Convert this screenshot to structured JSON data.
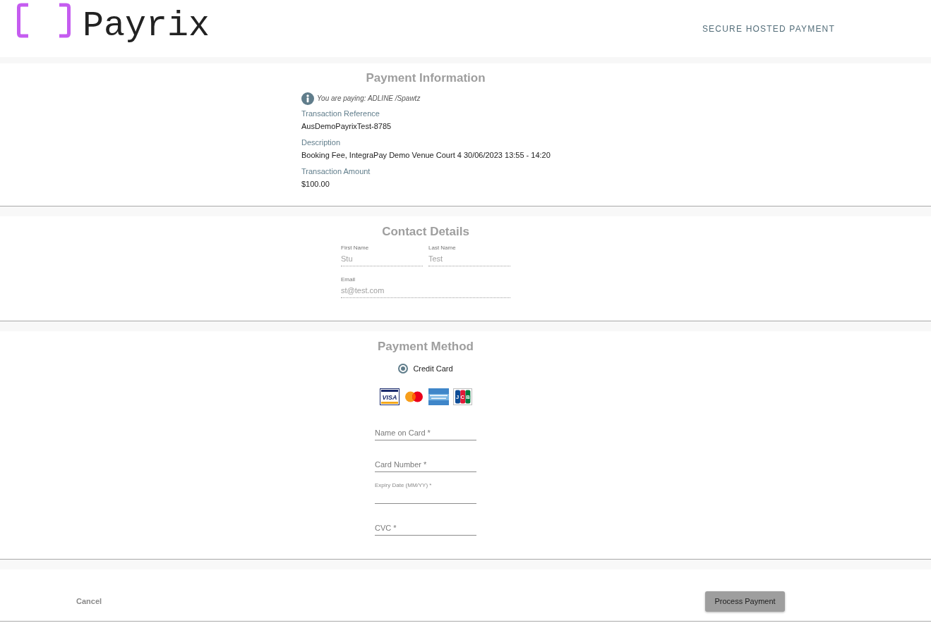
{
  "header": {
    "logo_text": "Payrix",
    "tagline": "SECURE HOSTED PAYMENT"
  },
  "payment_information": {
    "title": "Payment Information",
    "notice": "You are paying: ADLINE /Spawtz",
    "details": [
      {
        "label": "Transaction Reference",
        "value": "AusDemoPayrixTest-8785"
      },
      {
        "label": "Description",
        "value": "Booking Fee, IntegraPay Demo Venue Court 4 30/06/2023 13:55 - 14:20"
      },
      {
        "label": "Transaction Amount",
        "value": "$100.00"
      }
    ]
  },
  "contact_details": {
    "title": "Contact Details",
    "fields": [
      {
        "label": "First Name",
        "value": "Stu",
        "disabled": true
      },
      {
        "label": "Last Name",
        "value": "Test",
        "disabled": true
      },
      {
        "label": "Email",
        "value": "st@test.com",
        "disabled": true
      }
    ]
  },
  "payment_method": {
    "title": "Payment Method",
    "options": [
      {
        "label": "Credit Card",
        "selected": true
      }
    ],
    "card_brands": [
      {
        "kind": "visa",
        "text": "VISA"
      },
      {
        "kind": "mastercard"
      },
      {
        "kind": "amex"
      },
      {
        "kind": "jcb",
        "text": "JCB"
      }
    ],
    "card_fields": [
      {
        "kind": "placeholder",
        "placeholder": "Name on Card *"
      },
      {
        "kind": "placeholder",
        "placeholder": "Card Number *"
      },
      {
        "kind": "floating_label",
        "label": "Expiry Date (MM/YY) *"
      },
      {
        "kind": "placeholder",
        "placeholder": "CVC *"
      }
    ]
  },
  "actions": {
    "cancel": "Cancel",
    "submit": "Process Payment"
  }
}
